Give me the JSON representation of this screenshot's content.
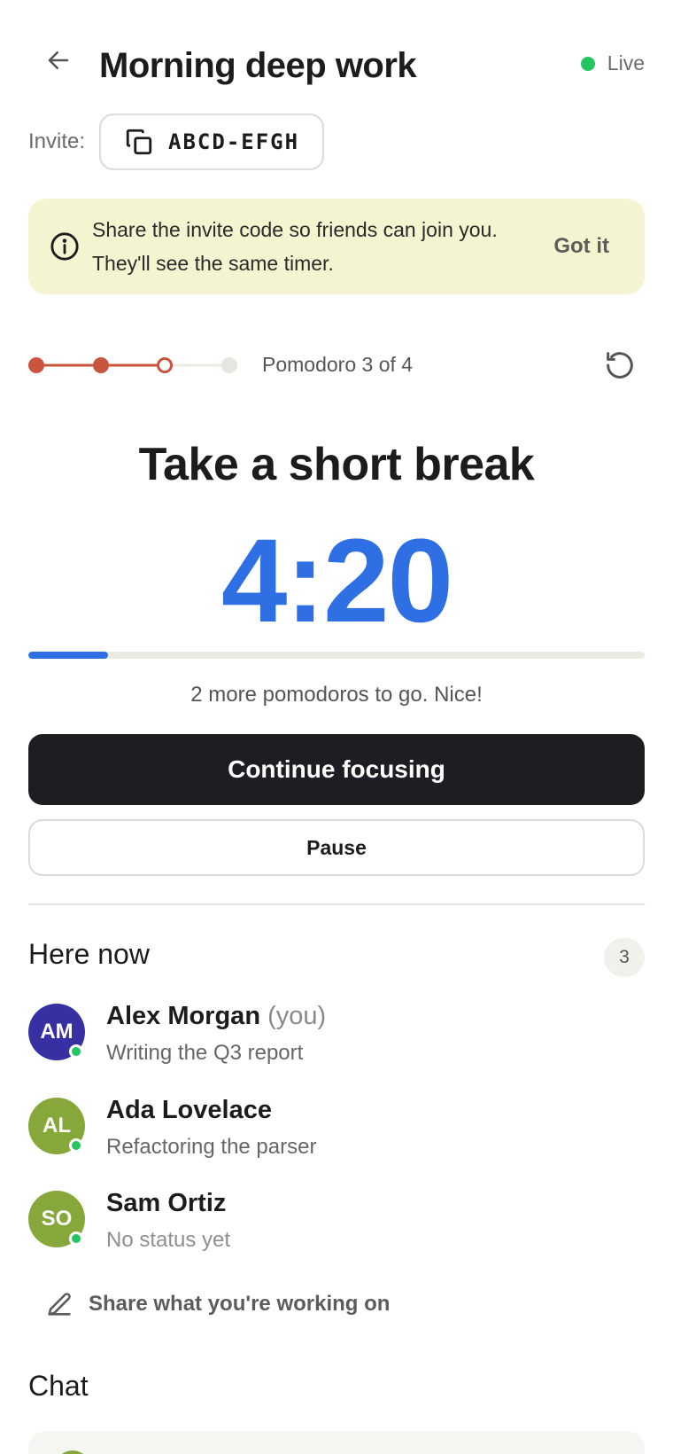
{
  "header": {
    "title": "Morning deep work",
    "live_label": "Live"
  },
  "invite": {
    "label": "Invite:",
    "code": "ABCD-EFGH"
  },
  "banner": {
    "text": "Share the invite code so friends can join you. They'll see the same timer.",
    "dismiss_label": "Got it"
  },
  "session": {
    "steps_label": "Pomodoro 3 of 4",
    "phase_title": "Take a short break",
    "timer": "4:20",
    "progress_fraction": 0.13,
    "hint": "2 more pomodoros to go. Nice!",
    "primary_label": "Continue focusing",
    "secondary_label": "Pause"
  },
  "presence": {
    "title": "Here now",
    "count": "3",
    "members": [
      {
        "initials": "AM",
        "name": "Alex Morgan",
        "you_label": "(you)",
        "status": "Writing the Q3 report",
        "color": "#3730a3"
      },
      {
        "initials": "AL",
        "name": "Ada Lovelace",
        "status": "Refactoring the parser",
        "color": "#86a83a"
      },
      {
        "initials": "SO",
        "name": "Sam Ortiz",
        "status": "No status yet",
        "color": "#86a83a"
      }
    ],
    "share_label": "Share what you're working on"
  },
  "chat": {
    "title": "Chat"
  },
  "colors": {
    "accent": "#2f6fe4",
    "step_active": "#c8553d",
    "live": "#22c55e",
    "banner_bg": "#f5f4d0"
  }
}
